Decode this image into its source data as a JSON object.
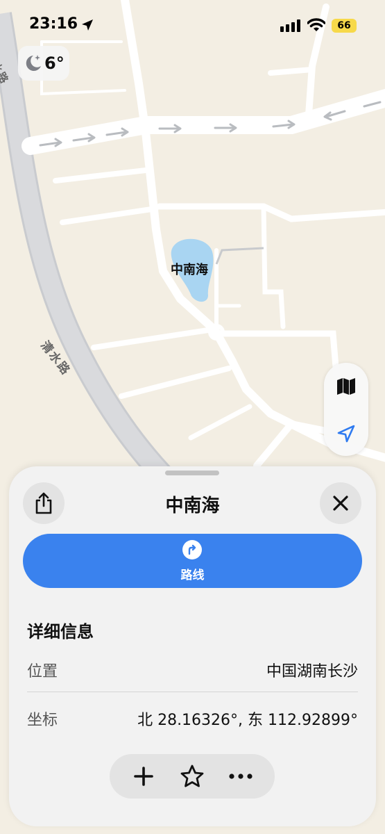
{
  "status_bar": {
    "time": "23:16",
    "battery": "66",
    "icons": [
      "location-arrow-icon",
      "signal-icon",
      "wifi-icon",
      "battery-icon"
    ]
  },
  "weather": {
    "temperature": "6°",
    "icon": "moon-stars-icon"
  },
  "map": {
    "poi_label": "中南海",
    "road_labels": [
      "清水路",
      "清水路"
    ],
    "colors": {
      "land": "#f3eee3",
      "road": "#ffffff",
      "major_road": "#d4d6da",
      "water": "#a9d5f2",
      "arrow": "#b9bcc0"
    }
  },
  "map_controls": {
    "items": [
      "map-icon",
      "location-arrow-icon"
    ]
  },
  "place_sheet": {
    "title": "中南海",
    "share_icon": "share-icon",
    "close_icon": "close-icon",
    "route_button": {
      "label": "路线",
      "icon": "directions-icon",
      "color": "#3a82ee"
    },
    "details_title": "详细信息",
    "details": [
      {
        "label": "位置",
        "value": "中国湖南长沙"
      },
      {
        "label": "坐标",
        "value": "北 28.16326°, 东 112.92899°"
      }
    ],
    "toolbar": [
      "plus-icon",
      "star-icon",
      "more-icon"
    ]
  }
}
